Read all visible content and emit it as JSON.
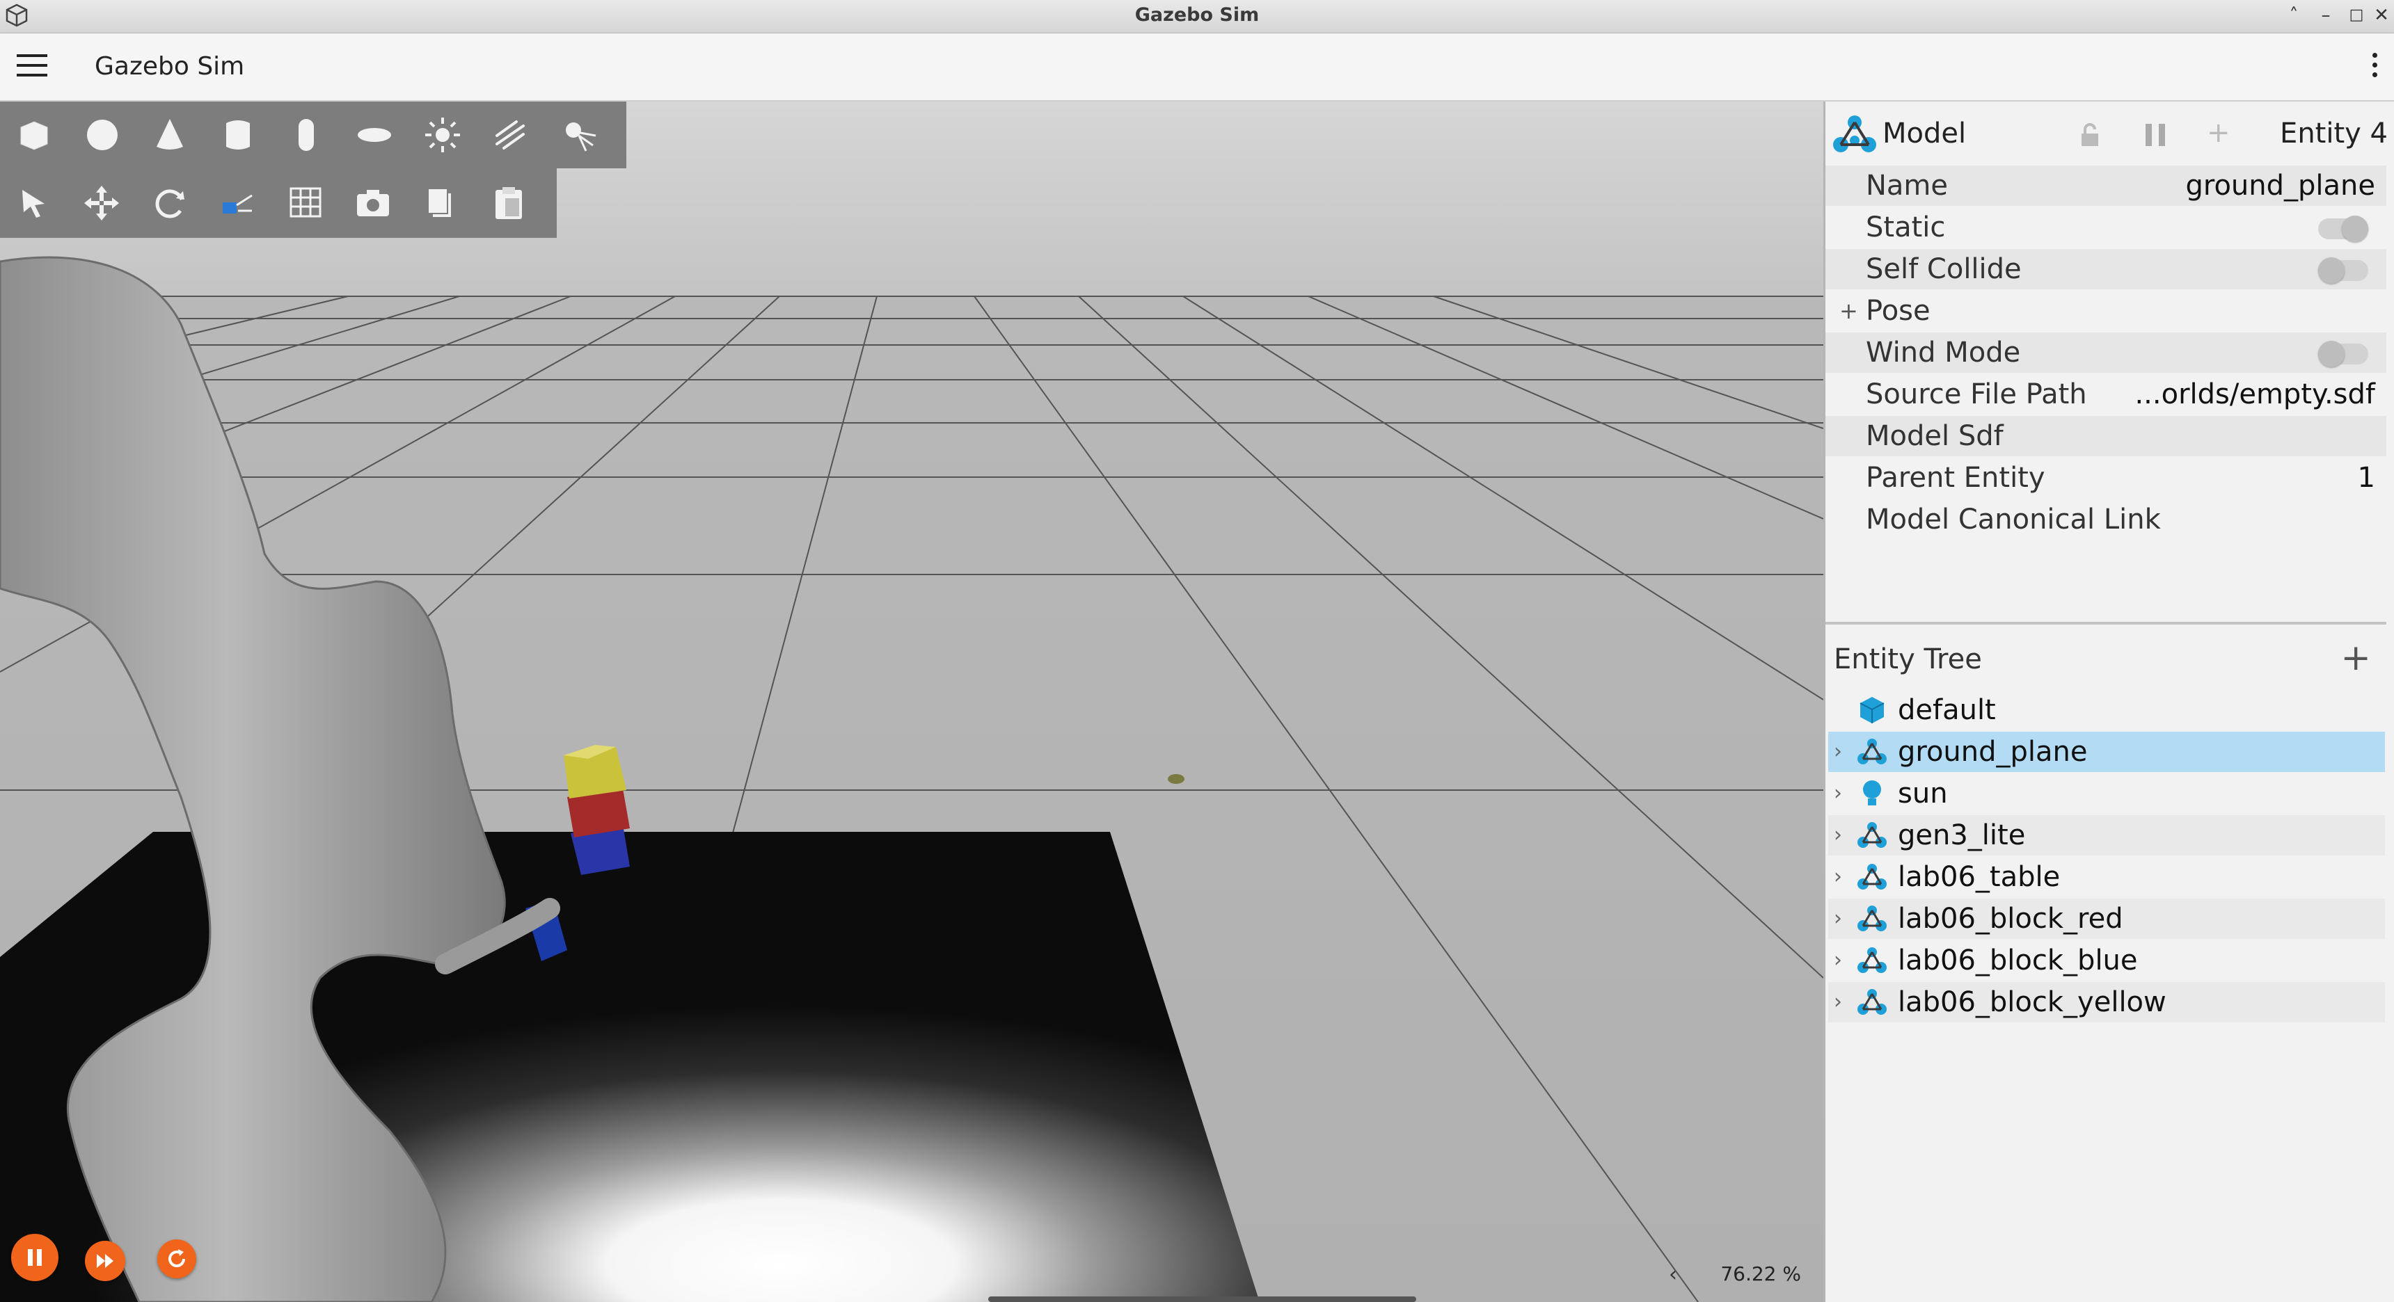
{
  "window": {
    "title": "Gazebo Sim"
  },
  "app": {
    "title": "Gazebo Sim"
  },
  "toolbar": {
    "shapes": [
      "box-icon",
      "sphere-icon",
      "cone-icon",
      "cylinder-icon",
      "capsule-icon",
      "ellipsoid-icon",
      "sun-light-icon",
      "directional-light-icon",
      "spot-light-icon"
    ],
    "tools": [
      "select-icon",
      "translate-icon",
      "rotate-icon",
      "transform-control-icon",
      "grid-snap-icon",
      "screenshot-icon",
      "copy-icon",
      "paste-icon"
    ]
  },
  "viewport": {
    "rtf": "76.22 %",
    "rtf_arrow": "‹"
  },
  "component_inspector": {
    "type": "Model",
    "entity": "Entity 4",
    "rows": [
      {
        "label": "Name",
        "value": "ground_plane"
      },
      {
        "label": "Static",
        "value": ""
      },
      {
        "label": "Self Collide",
        "value": ""
      },
      {
        "label": "Pose",
        "value": ""
      },
      {
        "label": "Wind Mode",
        "value": ""
      },
      {
        "label": "Source File Path",
        "value": "...orlds/empty.sdf"
      },
      {
        "label": "Model Sdf",
        "value": ""
      },
      {
        "label": "Parent Entity",
        "value": "1"
      },
      {
        "label": "Model Canonical Link",
        "value": ""
      }
    ],
    "pose_expander": "+",
    "add_glyph": "+"
  },
  "entity_tree": {
    "title": "Entity Tree",
    "add_glyph": "+",
    "chevron": "›",
    "items": [
      {
        "name": "default"
      },
      {
        "name": "ground_plane"
      },
      {
        "name": "sun"
      },
      {
        "name": "gen3_lite"
      },
      {
        "name": "lab06_table"
      },
      {
        "name": "lab06_block_red"
      },
      {
        "name": "lab06_block_blue"
      },
      {
        "name": "lab06_block_yellow"
      }
    ]
  },
  "colors": {
    "accent": "#f0641c",
    "selection": "#b3dcf4",
    "model_icon": "#1fa0d8",
    "block_red": "#b02828",
    "block_blue": "#2233aa",
    "block_yellow": "#c8c028"
  }
}
